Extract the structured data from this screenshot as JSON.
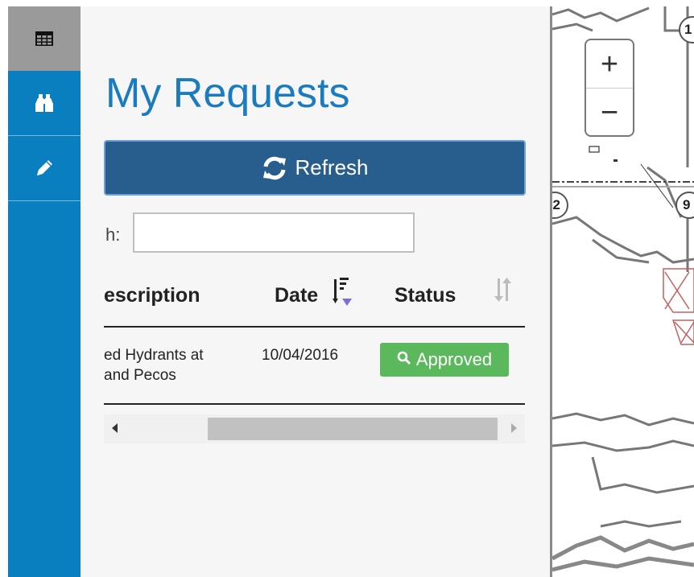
{
  "sidebar": {
    "items": [
      {
        "name": "table-icon",
        "active": true
      },
      {
        "name": "binoculars-icon",
        "active": false
      },
      {
        "name": "pencil-icon",
        "active": false
      }
    ]
  },
  "panel": {
    "title": "My Requests",
    "refresh_label": "Refresh",
    "search_label": "h:",
    "search_value": "",
    "table": {
      "columns": [
        "escription",
        "Date",
        "Status"
      ],
      "rows": [
        {
          "description_lines": [
            "ed Hydrants at",
            "and Pecos"
          ],
          "date": "10/04/2016",
          "status": "Approved"
        }
      ]
    }
  },
  "map": {
    "route_markers": [
      "1",
      "2",
      "9"
    ]
  },
  "colors": {
    "sidebar": "#0a7fc0",
    "title": "#1a7bbf",
    "refresh_button": "#285e8e",
    "status_approved": "#5cb85c"
  }
}
